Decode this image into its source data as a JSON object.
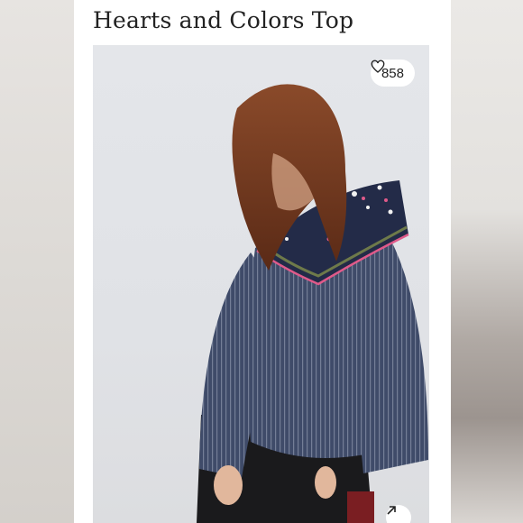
{
  "listing": {
    "title": "Hearts and Colors Top",
    "likes": "858"
  },
  "icons": {
    "like": "heart-outline-icon",
    "share": "arrow-up-right-icon"
  },
  "colors": {
    "card_background": "#ffffff",
    "photo_background": "#e2e4e8",
    "shirt_navy": "#3e4a66",
    "hair_auburn": "#7a3e22"
  }
}
